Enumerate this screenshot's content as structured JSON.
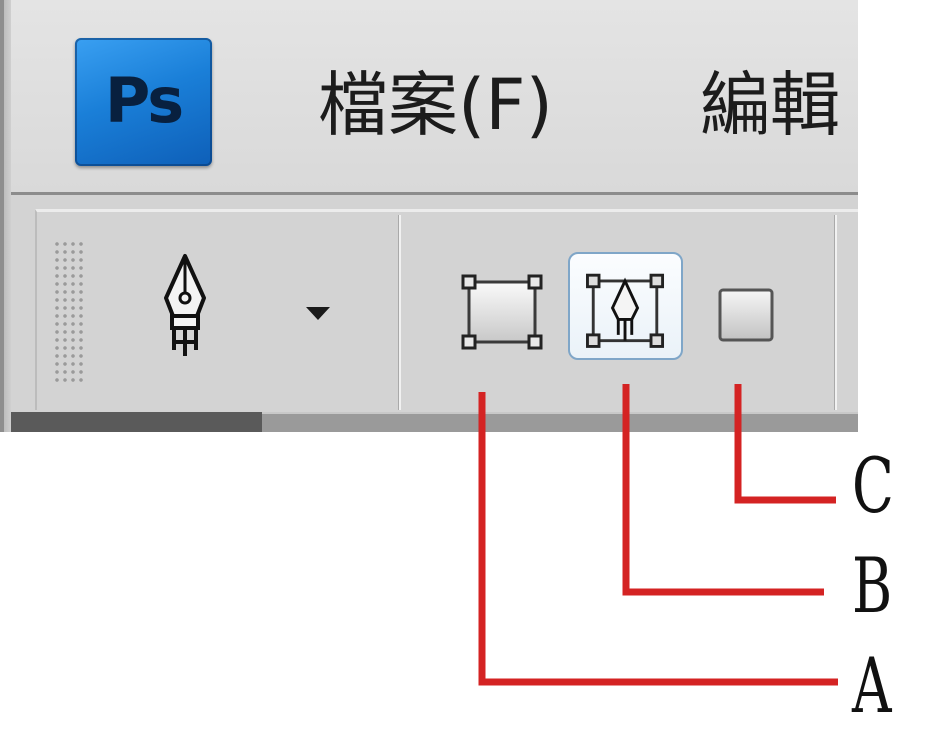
{
  "app": {
    "logo_text": "Ps",
    "menu": [
      {
        "label": "檔案(F)"
      },
      {
        "label": "編輯"
      }
    ]
  },
  "options_bar": {
    "tool_icon": "pen-tool-icon",
    "dropdown_icon": "dropdown-arrow-icon",
    "modes": [
      {
        "icon": "shape-layers-icon"
      },
      {
        "icon": "paths-icon",
        "selected": true
      },
      {
        "icon": "fill-pixels-icon"
      }
    ]
  },
  "callouts": {
    "a": "A",
    "b": "B",
    "c": "C"
  },
  "colors": {
    "callout_line": "#d42323",
    "logo_blue": "#1a7fd8",
    "selected_border": "#7fa6c8"
  }
}
